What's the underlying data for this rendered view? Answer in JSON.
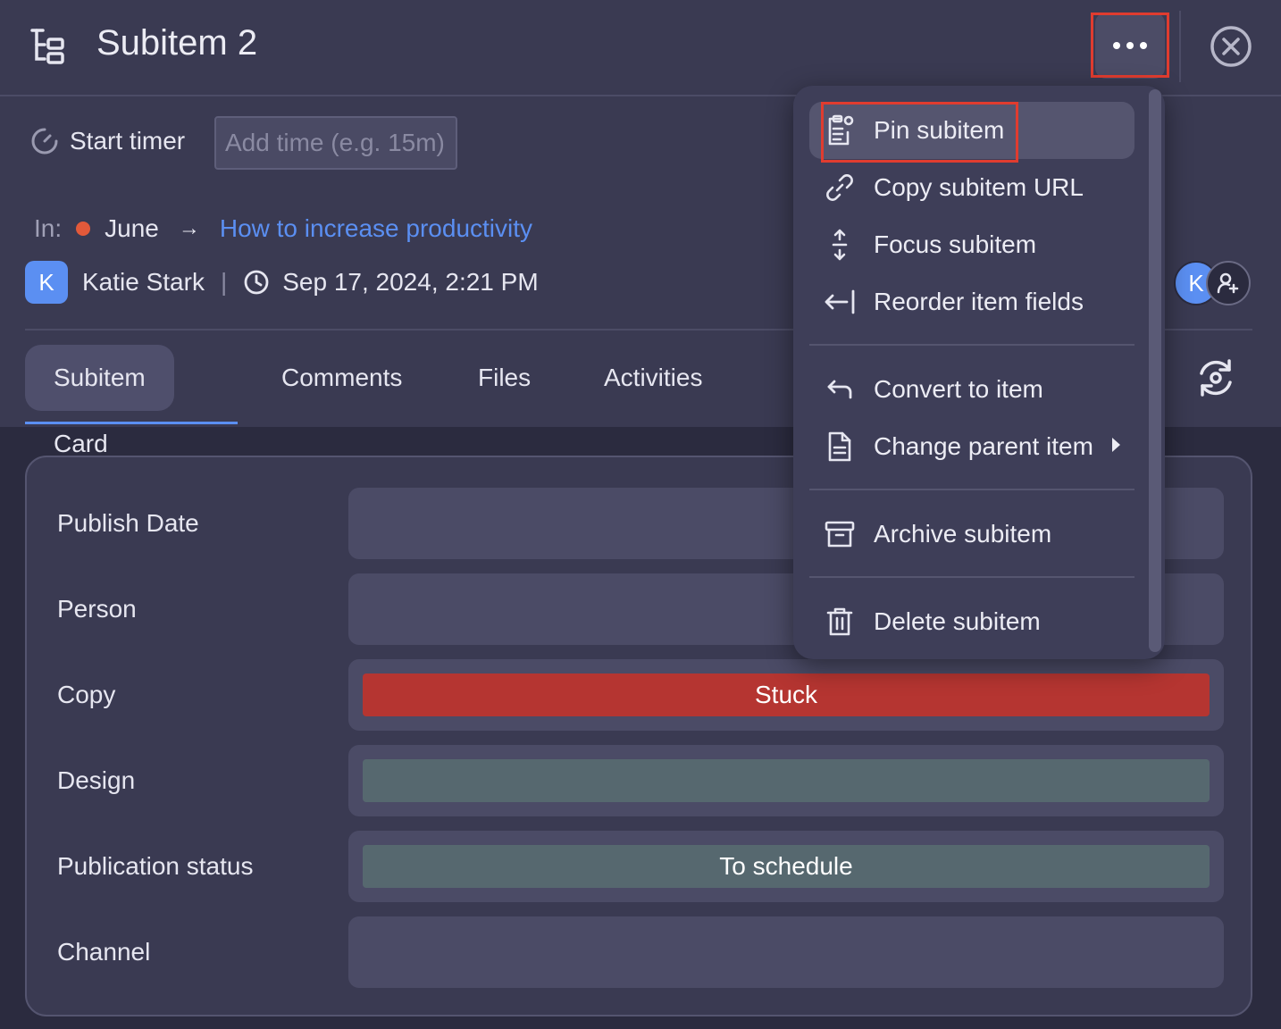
{
  "header": {
    "title": "Subitem 2",
    "icon": "subitem-tree-icon",
    "more_icon": "more-horizontal-icon",
    "close_icon": "close-circle-icon"
  },
  "timer": {
    "label": "Start timer",
    "icon": "timer-icon",
    "input_placeholder": "Add time (e.g. 15m)"
  },
  "breadcrumb": {
    "prefix": "In:",
    "group": "June",
    "group_color": "#e2593a",
    "parent": "How to increase productivity"
  },
  "meta": {
    "avatar_initial": "K",
    "owner": "Katie Stark",
    "separator": "|",
    "created": "Sep 17, 2024, 2:21 PM"
  },
  "subscribers": {
    "initial": "K"
  },
  "tabs": [
    {
      "label": "Subitem  Card",
      "active": true
    },
    {
      "label": "Comments"
    },
    {
      "label": "Files"
    },
    {
      "label": "Activities"
    }
  ],
  "fields": [
    {
      "label": "Publish Date",
      "value": ""
    },
    {
      "label": "Person",
      "value": ""
    },
    {
      "label": "Copy",
      "value": "Stuck",
      "color": "#b53531"
    },
    {
      "label": "Design",
      "value": "",
      "color": "#56686f"
    },
    {
      "label": "Publication status",
      "value": "To schedule",
      "color": "#56686f"
    },
    {
      "label": "Channel",
      "value": ""
    }
  ],
  "menu": {
    "items": [
      {
        "label": "Pin subitem",
        "icon": "pin-clipboard-icon"
      },
      {
        "label": "Copy subitem URL",
        "icon": "link-icon"
      },
      {
        "label": "Focus subitem",
        "icon": "focus-arrows-icon"
      },
      {
        "label": "Reorder item fields",
        "icon": "reorder-arrow-icon"
      },
      {
        "label": "Convert to item",
        "icon": "convert-arrow-icon"
      },
      {
        "label": "Change parent item",
        "icon": "document-icon"
      },
      {
        "label": "Archive subitem",
        "icon": "archive-icon"
      },
      {
        "label": "Delete subitem",
        "icon": "trash-icon"
      }
    ]
  },
  "colors": {
    "accent": "#5b8ff2",
    "highlight": "#e03c2f"
  }
}
